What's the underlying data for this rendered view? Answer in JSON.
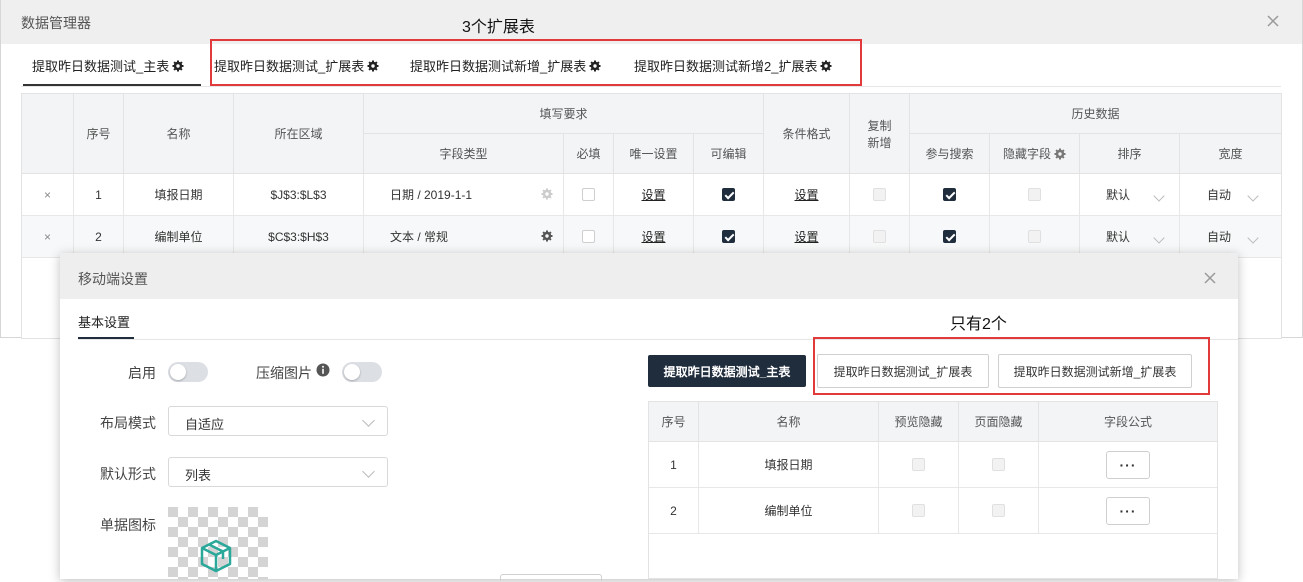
{
  "main_dialog": {
    "title": "数据管理器",
    "tabs": [
      {
        "label": "提取昨日数据测试_主表"
      },
      {
        "label": "提取昨日数据测试_扩展表"
      },
      {
        "label": "提取昨日数据测试新增_扩展表"
      },
      {
        "label": "提取昨日数据测试新增2_扩展表"
      }
    ],
    "annotation": "3个扩展表",
    "table": {
      "headers": {
        "index": "序号",
        "name": "名称",
        "region": "所在区域",
        "fill_req": "填写要求",
        "field_type": "字段类型",
        "required": "必填",
        "unique": "唯一设置",
        "editable": "可编辑",
        "cond_format": "条件格式",
        "copy_add": "复制新增",
        "history": "历史数据",
        "search": "参与搜索",
        "hidden_field": "隐藏字段",
        "sort": "排序",
        "width": "宽度"
      },
      "rows": [
        {
          "remove": "×",
          "index": "1",
          "name": "填报日期",
          "region": "$J$3:$L$3",
          "field_type": "日期 / 2019-1-1",
          "unique": "设置",
          "cond_format": "设置",
          "sort": "默认",
          "width": "自动"
        },
        {
          "remove": "×",
          "index": "2",
          "name": "编制单位",
          "region": "$C$3:$H$3",
          "field_type": "文本 / 常规",
          "unique": "设置",
          "cond_format": "设置",
          "sort": "默认",
          "width": "自动"
        }
      ]
    }
  },
  "mobile_dialog": {
    "title": "移动端设置",
    "tab": "基本设置",
    "annotation": "只有2个",
    "enable_label": "启用",
    "compress_label": "压缩图片",
    "layout_label": "布局模式",
    "layout_value": "自适应",
    "default_form_label": "默认形式",
    "default_form_value": "列表",
    "icon_label": "单据图标",
    "buttons": {
      "main": "提取昨日数据测试_主表",
      "ext1": "提取昨日数据测试_扩展表",
      "ext2": "提取昨日数据测试新增_扩展表"
    },
    "table": {
      "headers": {
        "index": "序号",
        "name": "名称",
        "preview_hide": "预览隐藏",
        "page_hide": "页面隐藏",
        "formula": "字段公式"
      },
      "rows": [
        {
          "index": "1",
          "name": "填报日期",
          "formula_btn": "···"
        },
        {
          "index": "2",
          "name": "编制单位",
          "formula_btn": "···"
        }
      ]
    }
  },
  "colors": {
    "accent": "#1f2d3d",
    "annotation_red": "#e23a3a",
    "header_bg": "#efefef"
  },
  "icons": [
    "gear-icon",
    "close-icon",
    "info-icon",
    "chevron-down-icon",
    "cube-icon"
  ]
}
